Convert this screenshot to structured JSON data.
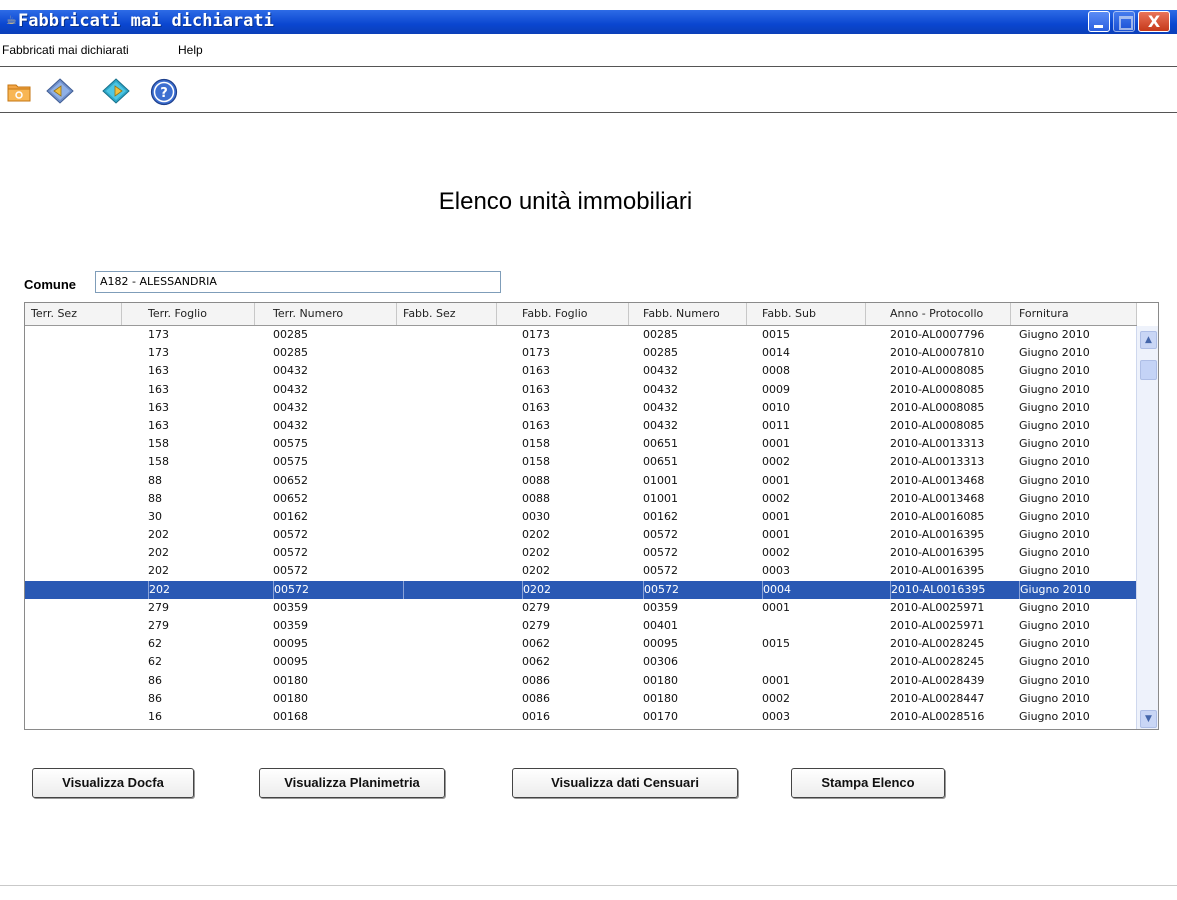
{
  "window": {
    "title": "Fabbricati mai dichiarati",
    "close_glyph": "X"
  },
  "menubar": {
    "items": [
      "Fabbricati mai dichiarati",
      "Help"
    ]
  },
  "toolbar": {
    "icons": [
      "folder-open-icon",
      "diamond-back-icon",
      "diamond-forward-icon",
      "help-icon"
    ]
  },
  "main": {
    "heading": "Elenco unità immobiliari",
    "comune_label": "Comune",
    "comune_value": "A182 - ALESSANDRIA"
  },
  "table": {
    "columns": [
      "Terr. Sez",
      "Terr. Foglio",
      "Terr. Numero",
      "Fabb. Sez",
      "Fabb. Foglio",
      "Fabb. Numero",
      "Fabb. Sub",
      "Anno - Protocollo",
      "Fornitura"
    ],
    "selected_index": 14,
    "rows": [
      [
        "",
        "173",
        "00285",
        "",
        "0173",
        "00285",
        "0015",
        "2010-AL0007796",
        "Giugno 2010"
      ],
      [
        "",
        "173",
        "00285",
        "",
        "0173",
        "00285",
        "0014",
        "2010-AL0007810",
        "Giugno 2010"
      ],
      [
        "",
        "163",
        "00432",
        "",
        "0163",
        "00432",
        "0008",
        "2010-AL0008085",
        "Giugno 2010"
      ],
      [
        "",
        "163",
        "00432",
        "",
        "0163",
        "00432",
        "0009",
        "2010-AL0008085",
        "Giugno 2010"
      ],
      [
        "",
        "163",
        "00432",
        "",
        "0163",
        "00432",
        "0010",
        "2010-AL0008085",
        "Giugno 2010"
      ],
      [
        "",
        "163",
        "00432",
        "",
        "0163",
        "00432",
        "0011",
        "2010-AL0008085",
        "Giugno 2010"
      ],
      [
        "",
        "158",
        "00575",
        "",
        "0158",
        "00651",
        "0001",
        "2010-AL0013313",
        "Giugno 2010"
      ],
      [
        "",
        "158",
        "00575",
        "",
        "0158",
        "00651",
        "0002",
        "2010-AL0013313",
        "Giugno 2010"
      ],
      [
        "",
        "88",
        "00652",
        "",
        "0088",
        "01001",
        "0001",
        "2010-AL0013468",
        "Giugno 2010"
      ],
      [
        "",
        "88",
        "00652",
        "",
        "0088",
        "01001",
        "0002",
        "2010-AL0013468",
        "Giugno 2010"
      ],
      [
        "",
        "30",
        "00162",
        "",
        "0030",
        "00162",
        "0001",
        "2010-AL0016085",
        "Giugno 2010"
      ],
      [
        "",
        "202",
        "00572",
        "",
        "0202",
        "00572",
        "0001",
        "2010-AL0016395",
        "Giugno 2010"
      ],
      [
        "",
        "202",
        "00572",
        "",
        "0202",
        "00572",
        "0002",
        "2010-AL0016395",
        "Giugno 2010"
      ],
      [
        "",
        "202",
        "00572",
        "",
        "0202",
        "00572",
        "0003",
        "2010-AL0016395",
        "Giugno 2010"
      ],
      [
        "",
        "202",
        "00572",
        "",
        "0202",
        "00572",
        "0004",
        "2010-AL0016395",
        "Giugno 2010"
      ],
      [
        "",
        "279",
        "00359",
        "",
        "0279",
        "00359",
        "0001",
        "2010-AL0025971",
        "Giugno 2010"
      ],
      [
        "",
        "279",
        "00359",
        "",
        "0279",
        "00401",
        "",
        "2010-AL0025971",
        "Giugno 2010"
      ],
      [
        "",
        "62",
        "00095",
        "",
        "0062",
        "00095",
        "0015",
        "2010-AL0028245",
        "Giugno 2010"
      ],
      [
        "",
        "62",
        "00095",
        "",
        "0062",
        "00306",
        "",
        "2010-AL0028245",
        "Giugno 2010"
      ],
      [
        "",
        "86",
        "00180",
        "",
        "0086",
        "00180",
        "0001",
        "2010-AL0028439",
        "Giugno 2010"
      ],
      [
        "",
        "86",
        "00180",
        "",
        "0086",
        "00180",
        "0002",
        "2010-AL0028447",
        "Giugno 2010"
      ],
      [
        "",
        "16",
        "00168",
        "",
        "0016",
        "00170",
        "0003",
        "2010-AL0028516",
        "Giugno 2010"
      ]
    ]
  },
  "buttons": {
    "docfa": "Visualizza Docfa",
    "planimetria": "Visualizza Planimetria",
    "censuari": "Visualizza dati Censuari",
    "stampa": "Stampa Elenco"
  },
  "colors": {
    "titlebar": "#0a46d0",
    "selection": "#2a59b4"
  }
}
